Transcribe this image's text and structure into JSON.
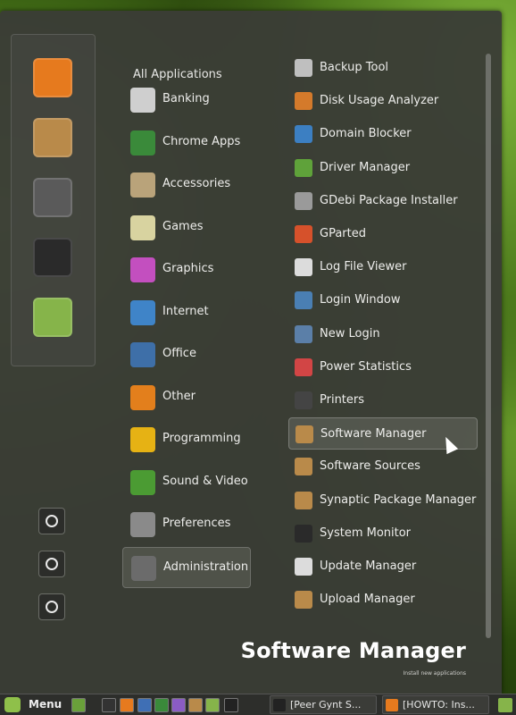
{
  "colors": {
    "menu_bg": "#3a3c36",
    "panel_bg": "#2d2e2b",
    "mint_green": "#8fc04a",
    "text": "#ededeb"
  },
  "favorites": [
    {
      "name": "firefox-icon",
      "color": "#e67a1e"
    },
    {
      "name": "package-installer-icon",
      "color": "#b98a4a"
    },
    {
      "name": "system-settings-icon",
      "color": "#5a5a5a"
    },
    {
      "name": "terminal-icon",
      "color": "#2a2a2a"
    },
    {
      "name": "files-folder-icon",
      "color": "#86b44a"
    }
  ],
  "quick_actions": [
    {
      "name": "lock-screen-icon"
    },
    {
      "name": "logout-icon"
    },
    {
      "name": "power-icon"
    }
  ],
  "categories_header": "All Applications",
  "categories": [
    {
      "label": "Banking",
      "icon": "banking-icon",
      "color": "#cfcfcf"
    },
    {
      "label": "Chrome Apps",
      "icon": "chrome-icon",
      "color": "#3a8a3a"
    },
    {
      "label": "Accessories",
      "icon": "accessories-icon",
      "color": "#b9a37a"
    },
    {
      "label": "Games",
      "icon": "games-icon",
      "color": "#d8d3a0"
    },
    {
      "label": "Graphics",
      "icon": "graphics-icon",
      "color": "#c34fbf"
    },
    {
      "label": "Internet",
      "icon": "internet-icon",
      "color": "#3f84c8"
    },
    {
      "label": "Office",
      "icon": "office-icon",
      "color": "#3e6fa8"
    },
    {
      "label": "Other",
      "icon": "other-icon",
      "color": "#e37f1c"
    },
    {
      "label": "Programming",
      "icon": "programming-icon",
      "color": "#e6b214"
    },
    {
      "label": "Sound & Video",
      "icon": "sound-video-icon",
      "color": "#4b9b33"
    },
    {
      "label": "Preferences",
      "icon": "preferences-icon",
      "color": "#8a8a8a"
    },
    {
      "label": "Administration",
      "icon": "administration-icon",
      "color": "#6b6b6b",
      "selected": true
    }
  ],
  "apps": [
    {
      "label": "Backup Tool",
      "icon": "backup-tool-icon",
      "color": "#bfbfbf"
    },
    {
      "label": "Disk Usage Analyzer",
      "icon": "disk-usage-icon",
      "color": "#d47a2b"
    },
    {
      "label": "Domain Blocker",
      "icon": "domain-blocker-icon",
      "color": "#3c7fc2"
    },
    {
      "label": "Driver Manager",
      "icon": "driver-manager-icon",
      "color": "#5fa23a"
    },
    {
      "label": "GDebi Package Installer",
      "icon": "gdebi-icon",
      "color": "#9a9a9a"
    },
    {
      "label": "GParted",
      "icon": "gparted-icon",
      "color": "#d6512b"
    },
    {
      "label": "Log File Viewer",
      "icon": "log-viewer-icon",
      "color": "#dcdcdc"
    },
    {
      "label": "Login Window",
      "icon": "login-window-icon",
      "color": "#4a7fb3"
    },
    {
      "label": "New Login",
      "icon": "new-login-icon",
      "color": "#5b7fa8"
    },
    {
      "label": "Power Statistics",
      "icon": "power-statistics-icon",
      "color": "#d24545"
    },
    {
      "label": "Printers",
      "icon": "printers-icon",
      "color": "#444444"
    },
    {
      "label": "Software Manager",
      "icon": "software-manager-icon",
      "color": "#b98a4a",
      "hovered": true
    },
    {
      "label": "Software Sources",
      "icon": "software-sources-icon",
      "color": "#b98a4a"
    },
    {
      "label": "Synaptic Package Manager",
      "icon": "synaptic-icon",
      "color": "#b98a4a"
    },
    {
      "label": "System Monitor",
      "icon": "system-monitor-icon",
      "color": "#2a2a2a"
    },
    {
      "label": "Update Manager",
      "icon": "update-manager-icon",
      "color": "#dcdcdc"
    },
    {
      "label": "Upload Manager",
      "icon": "upload-manager-icon",
      "color": "#b98a4a"
    }
  ],
  "selected_app": {
    "title": "Software Manager",
    "description": "Install new applications"
  },
  "panel": {
    "menu_label": "Menu",
    "launchers": [
      {
        "name": "show-desktop-icon",
        "color": "#6aa03a"
      },
      {
        "name": "terminal-launcher-icon",
        "color": "#333333"
      },
      {
        "name": "firefox-launcher-icon",
        "color": "#e67a1e"
      },
      {
        "name": "thunderbird-launcher-icon",
        "color": "#3f6fb5"
      },
      {
        "name": "chrome-launcher-icon",
        "color": "#3a8a3a"
      },
      {
        "name": "pidgin-launcher-icon",
        "color": "#8a5cc4"
      },
      {
        "name": "software-manager-launcher-icon",
        "color": "#b98a4a"
      },
      {
        "name": "files-launcher-icon",
        "color": "#86b44a"
      },
      {
        "name": "music-launcher-icon",
        "color": "#222222"
      }
    ],
    "tasks": [
      {
        "label": "[Peer Gynt S...",
        "icon": "music-task-icon",
        "color": "#222222"
      },
      {
        "label": "[HOWTO: Ins...",
        "icon": "firefox-task-icon",
        "color": "#e67a1e"
      }
    ],
    "tray_icon": {
      "name": "folder-tray-icon",
      "color": "#86b44a"
    }
  }
}
